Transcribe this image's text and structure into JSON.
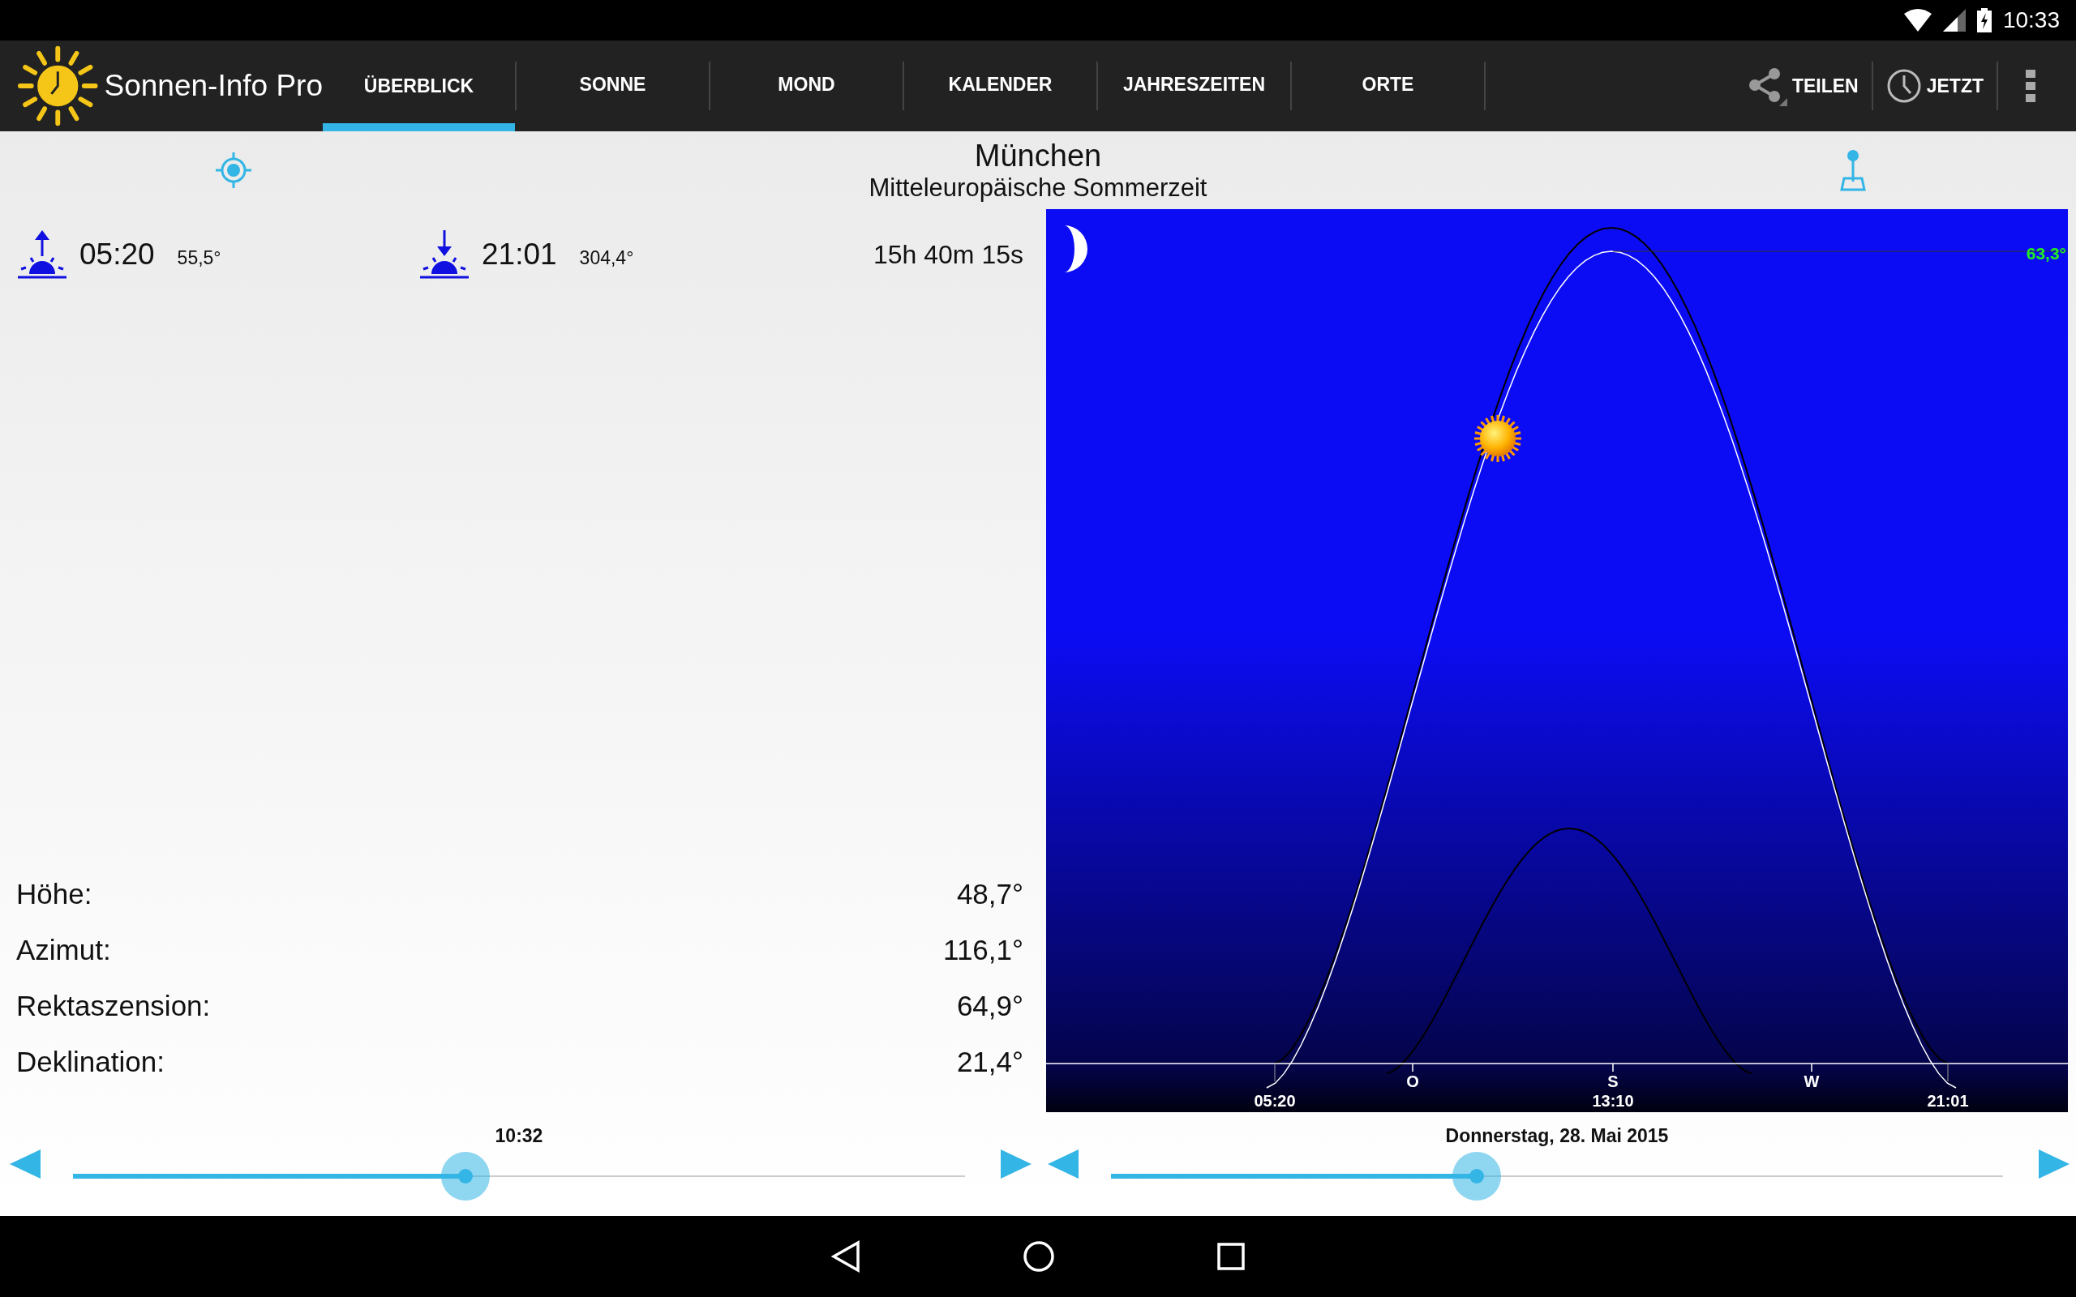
{
  "status_bar": {
    "time": "10:33"
  },
  "app_bar": {
    "title": "Sonnen-Info Pro",
    "tabs": [
      {
        "label": "ÜBERBLICK",
        "selected": true
      },
      {
        "label": "SONNE",
        "selected": false
      },
      {
        "label": "MOND",
        "selected": false
      },
      {
        "label": "KALENDER",
        "selected": false
      },
      {
        "label": "JAHRESZEITEN",
        "selected": false
      },
      {
        "label": "ORTE",
        "selected": false
      }
    ],
    "actions": [
      {
        "label": "TEILEN",
        "kind": "share"
      },
      {
        "label": "JETZT",
        "kind": "clock"
      }
    ]
  },
  "location": {
    "city": "München",
    "timezone": "Mitteleuropäische Sommerzeit"
  },
  "sun_times": {
    "sunrise": {
      "time": "05:20",
      "azimuth": "55,5°"
    },
    "sunset": {
      "time": "21:01",
      "azimuth": "304,4°"
    },
    "day_length": "15h 40m 15s"
  },
  "values": [
    {
      "label": "Höhe:",
      "value": "48,7°"
    },
    {
      "label": "Azimut:",
      "value": "116,1°"
    },
    {
      "label": "Rektaszension:",
      "value": "64,9°"
    },
    {
      "label": "Deklination:",
      "value": "21,4°"
    }
  ],
  "time_slider": {
    "label": "10:32",
    "level": 0.44
  },
  "date_slider": {
    "label": "Donnerstag, 28. Mai 2015",
    "level": 0.41
  },
  "sun_chart": {
    "max_altitude": "63,3°",
    "sunrise": "05:20",
    "noon": "13:10",
    "sunset": "21:01",
    "directions": [
      "O",
      "S",
      "W"
    ]
  }
}
